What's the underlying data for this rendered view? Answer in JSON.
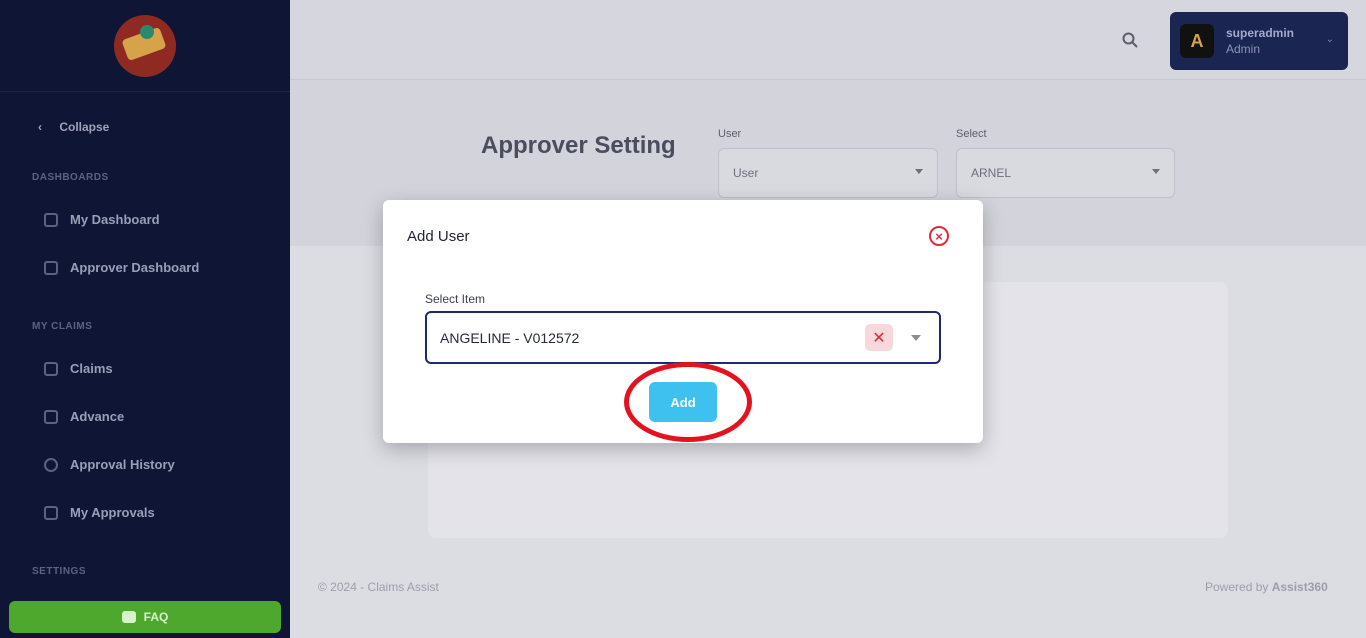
{
  "sidebar": {
    "collapse_label": "Collapse",
    "sections": {
      "dashboards": "DASHBOARDS",
      "my_claims": "MY CLAIMS",
      "settings": "SETTINGS"
    },
    "items": [
      {
        "label": "My Dashboard",
        "icon": "dashboard-icon"
      },
      {
        "label": "Approver Dashboard",
        "icon": "document-icon"
      },
      {
        "label": "Claims",
        "icon": "claims-icon"
      },
      {
        "label": "Advance",
        "icon": "document-icon"
      },
      {
        "label": "Approval History",
        "icon": "clock-icon"
      },
      {
        "label": "My Approvals",
        "icon": "document-icon"
      }
    ],
    "faq_label": "FAQ"
  },
  "header": {
    "user_name": "superadmin",
    "user_role": "Admin",
    "avatar_letter": "A"
  },
  "page": {
    "title": "Approver Setting",
    "filters": {
      "user_label": "User",
      "user_value": "User",
      "select_label": "Select",
      "select_value": "ARNEL"
    }
  },
  "footer": {
    "copyright": "© 2024 - Claims Assist",
    "powered_prefix": "Powered by ",
    "powered_brand": "Assist360"
  },
  "modal": {
    "title": "Add User",
    "field_label": "Select Item",
    "selected_value": "ANGELINE - V012572",
    "add_label": "Add"
  },
  "colors": {
    "sidebar_bg": "#0f1635",
    "accent_blue": "#3fc1f0",
    "danger_red": "#e02a3c",
    "faq_green": "#4ea82e",
    "highlight_ring": "#e4121f"
  }
}
